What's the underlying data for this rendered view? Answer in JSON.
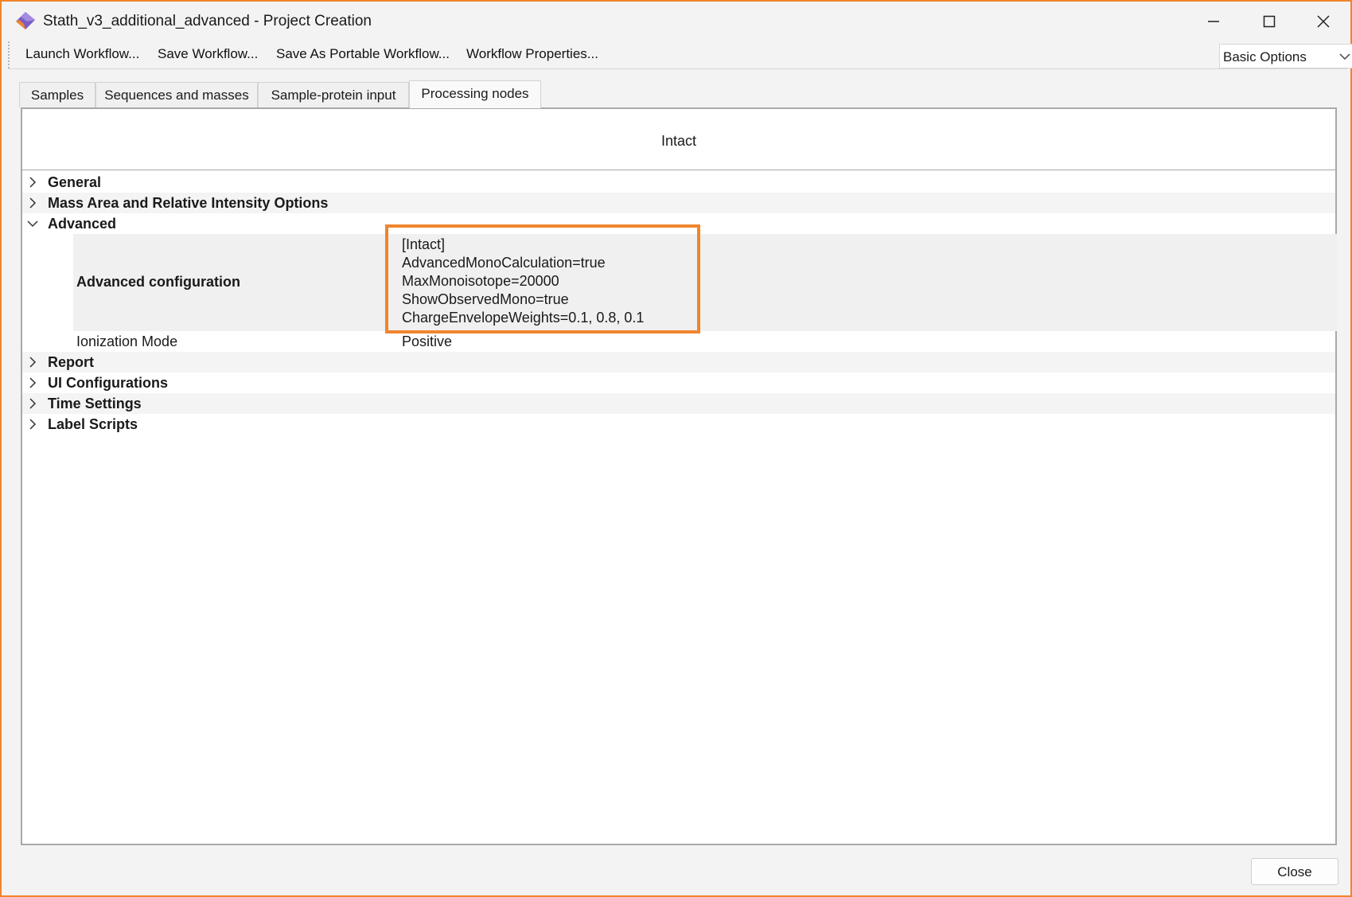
{
  "window": {
    "title": "Stath_v3_additional_advanced - Project Creation",
    "accent_color": "#f0852d"
  },
  "toolbar": {
    "items": [
      "Launch Workflow...",
      "Save Workflow...",
      "Save As Portable Workflow...",
      "Workflow Properties..."
    ],
    "options_select": {
      "value": "Basic Options"
    }
  },
  "tabs": [
    {
      "label": "Samples",
      "active": false
    },
    {
      "label": "Sequences and masses",
      "active": false
    },
    {
      "label": "Sample-protein input",
      "active": false
    },
    {
      "label": "Processing nodes",
      "active": true
    }
  ],
  "node": {
    "title": "Intact",
    "sections": {
      "general": {
        "label": "General",
        "expanded": false
      },
      "mass_area": {
        "label": "Mass Area and Relative Intensity Options",
        "expanded": false
      },
      "advanced": {
        "label": "Advanced",
        "expanded": true,
        "advanced_configuration": {
          "label": "Advanced configuration",
          "lines": [
            "[Intact]",
            "AdvancedMonoCalculation=true",
            "MaxMonoisotope=20000",
            "ShowObservedMono=true",
            "ChargeEnvelopeWeights=0.1, 0.8, 0.1"
          ]
        },
        "ionization_mode": {
          "label": "Ionization Mode",
          "value": "Positive"
        }
      },
      "report": {
        "label": "Report",
        "expanded": false
      },
      "ui_configurations": {
        "label": "UI Configurations",
        "expanded": false
      },
      "time_settings": {
        "label": "Time Settings",
        "expanded": false
      },
      "label_scripts": {
        "label": "Label Scripts",
        "expanded": false
      }
    }
  },
  "footer": {
    "close_label": "Close"
  }
}
